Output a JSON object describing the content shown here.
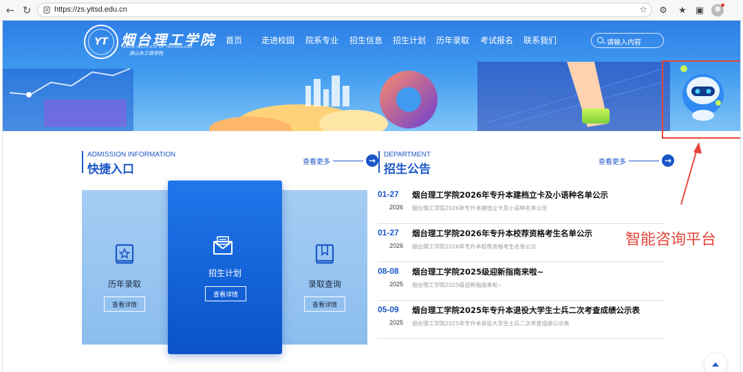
{
  "browser": {
    "url": "https://zs.yitsd.edu.cn"
  },
  "site": {
    "logo_name": "烟台理工学院",
    "logo_en": "YANTAI INSTITUTE OF TECHNOLOGY",
    "logo_sub": "原山东工商学院"
  },
  "nav": {
    "items": [
      "首页",
      "走进校园",
      "院系专业",
      "招生信息",
      "招生计划",
      "历年录取",
      "考试报名",
      "联系我们"
    ]
  },
  "search": {
    "placeholder": "请输入内容"
  },
  "quick": {
    "en": "ADMISSION INFORMATION",
    "zh": "快捷入口",
    "more": "查看更多",
    "cards": [
      {
        "label": "历年录取",
        "button": "查看详情",
        "icon": "star-book-icon"
      },
      {
        "label": "招生计划",
        "button": "查看详情",
        "icon": "mail-icon"
      },
      {
        "label": "录取查询",
        "button": "查看详情",
        "icon": "bookmark-book-icon"
      }
    ]
  },
  "notices": {
    "en": "DEPARTMENT",
    "zh": "招生公告",
    "more": "查看更多",
    "items": [
      {
        "md": "01-27",
        "year": "2026",
        "title": "烟台理工学院2026年专升本建档立卡及小语种名单公示",
        "sub": "烟台理工学院2026年专升本建档立卡及小语种名单公示"
      },
      {
        "md": "01-27",
        "year": "2026",
        "title": "烟台理工学院2026年专升本校荐资格考生名单公示",
        "sub": "烟台理工学院2026年专升本校荐资格考生名单公示"
      },
      {
        "md": "08-08",
        "year": "2025",
        "title": "烟台理工学院2025级迎新指南来啦~",
        "sub": "烟台理工学院2025级迎新指南来啦~"
      },
      {
        "md": "05-09",
        "year": "2025",
        "title": "烟台理工学院2025年专升本退役大学生士兵二次考查成绩公示表",
        "sub": "烟台理工学院2025年专升本退役大学生士兵二次考查成绩公示表"
      }
    ]
  },
  "annotation": {
    "text": "智能咨询平台",
    "color": "#e5453b"
  },
  "colors": {
    "primary": "#1a57c7",
    "accent_red": "#e5453b"
  }
}
